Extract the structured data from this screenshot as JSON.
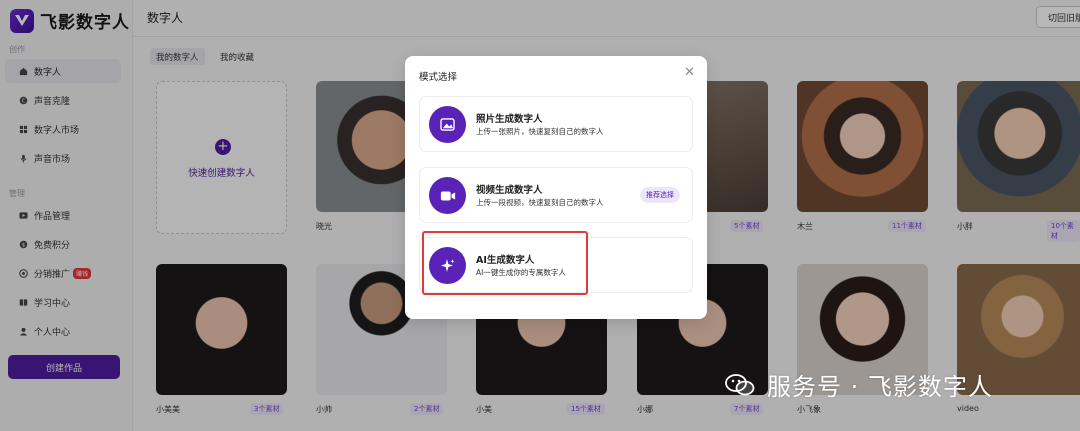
{
  "app": {
    "name": "飞影数字人"
  },
  "sidebar": {
    "section_create": "创作",
    "section_manage": "管理",
    "items": [
      {
        "label": "数字人",
        "icon": "home-icon",
        "active": true
      },
      {
        "label": "声音克隆",
        "icon": "voice-clone-icon"
      },
      {
        "label": "数字人市场",
        "icon": "grid-icon"
      },
      {
        "label": "声音市场",
        "icon": "mic-icon"
      },
      {
        "label": "作品管理",
        "icon": "video-icon"
      },
      {
        "label": "免费积分",
        "icon": "coin-icon"
      },
      {
        "label": "分销推广",
        "icon": "share-icon",
        "badge": "赚钱"
      },
      {
        "label": "学习中心",
        "icon": "book-icon"
      },
      {
        "label": "个人中心",
        "icon": "user-icon"
      }
    ],
    "create_button": "创建作品"
  },
  "header": {
    "title": "数字人",
    "switch_button": "切回旧版"
  },
  "tabs": [
    {
      "label": "我的数字人",
      "active": true
    },
    {
      "label": "我的收藏"
    }
  ],
  "grid": {
    "create_label": "快速创建数字人",
    "cards": [
      {
        "name": "晓光",
        "count": ""
      },
      {
        "name": "",
        "count": ""
      },
      {
        "name": "",
        "count": "5个素材"
      },
      {
        "name": "木兰",
        "count": "11个素材"
      },
      {
        "name": "小胖",
        "count": "10个素材"
      },
      {
        "name": "小美美",
        "count": "3个素材"
      },
      {
        "name": "小帅",
        "count": "2个素材"
      },
      {
        "name": "小美",
        "count": "15个素材"
      },
      {
        "name": "小娜",
        "count": "7个素材"
      },
      {
        "name": "小飞象",
        "count": ""
      },
      {
        "name": "video",
        "count": ""
      }
    ]
  },
  "modal": {
    "title": "模式选择",
    "options": [
      {
        "title": "照片生成数字人",
        "desc": "上传一张照片，快速复刻自己的数字人",
        "icon": "image-icon"
      },
      {
        "title": "视频生成数字人",
        "desc": "上传一段视频，快速复刻自己的数字人",
        "icon": "video-camera-icon",
        "badge": "推荐选择"
      },
      {
        "title": "AI生成数字人",
        "desc": "AI一键生成你的专属数字人",
        "icon": "sparkle-icon"
      }
    ]
  },
  "watermark": {
    "text": "服务号 · 飞影数字人"
  },
  "colors": {
    "brand": "#4e1e9e",
    "accent": "#5a22b6",
    "highlight": "#e03a3a",
    "hot_badge": "#e5353b"
  }
}
